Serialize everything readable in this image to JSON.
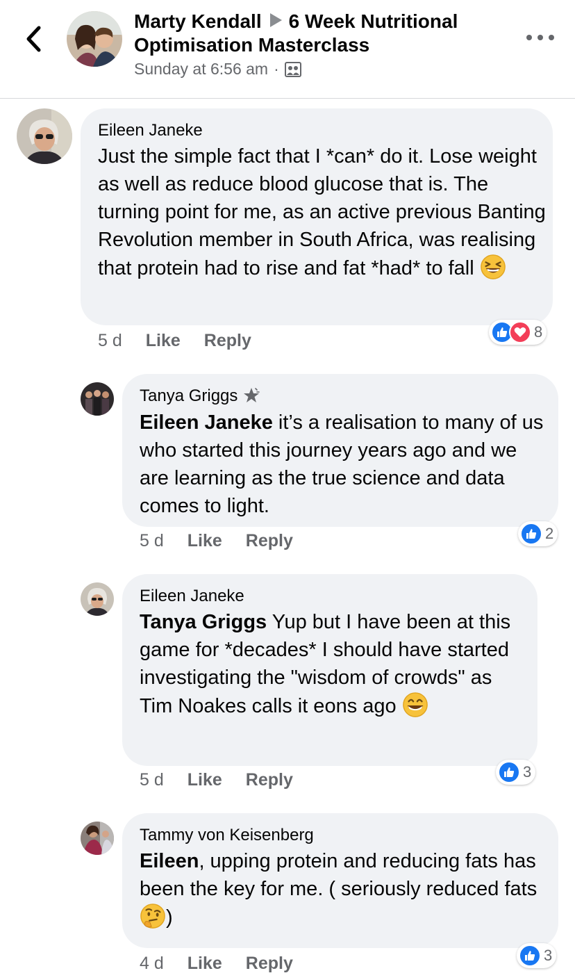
{
  "header": {
    "author": "Marty Kendall",
    "group": "6 Week Nutritional Optimisation Masterclass",
    "timestamp": "Sunday at 6:56 am",
    "separator": "·"
  },
  "comments": [
    {
      "author": "Eileen Janeke",
      "text": "Just the simple fact that I *can* do it. Lose weight as well as reduce blood glucose that is. The turning point for me, as an active previous Banting Revolution member in South Africa, was realising that protein had to rise and fat *had* to fall",
      "time": "5 d",
      "like_label": "Like",
      "reply_label": "Reply",
      "reaction_count": "8"
    },
    {
      "author": "Tanya Griggs",
      "mention": "Eileen Janeke",
      "text": " it’s a realisation to many of us who started this journey years ago and we are learning as the true science and data comes to light.",
      "time": "5 d",
      "like_label": "Like",
      "reply_label": "Reply",
      "reaction_count": "2"
    },
    {
      "author": "Eileen Janeke",
      "mention": "Tanya Griggs",
      "text": " Yup but I have been at this game for *decades* I should have started investigating the \"wisdom of crowds\" as Tim Noakes calls it eons ago",
      "time": "5 d",
      "like_label": "Like",
      "reply_label": "Reply",
      "reaction_count": "3"
    },
    {
      "author": "Tammy von Keisenberg",
      "mention": "Eileen",
      "text": ", upping protein and reducing fats has been the key for me. ( seriously reduced fats",
      "text_end": ")",
      "time": "4 d",
      "like_label": "Like",
      "reply_label": "Reply",
      "reaction_count": "3"
    }
  ],
  "colors": {
    "like": "#1877f2",
    "love": "#f33e58",
    "bubble": "#f0f2f5",
    "meta": "#65676b"
  }
}
